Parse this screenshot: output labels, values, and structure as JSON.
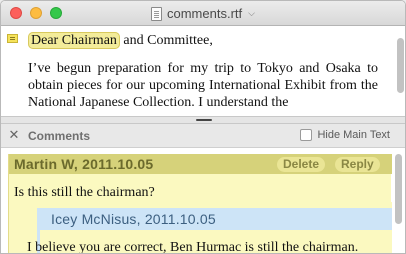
{
  "window": {
    "filename": "comments.rtf"
  },
  "document": {
    "paragraphs": [
      {
        "highlight": "Dear Chairman",
        "rest": " and Committee,"
      },
      {
        "text": "I’ve begun preparation for my trip to Tokyo and Osaka to obtain pieces for our upcoming International Exhibit from the National Japanese Collection. I understand the"
      }
    ]
  },
  "comments_panel": {
    "title": "Comments",
    "hide_main_text_label": "Hide Main Text",
    "hide_main_text_checked": false,
    "comment": {
      "author_date": "Martin W, 2011.10.05",
      "delete_label": "Delete",
      "reply_label": "Reply",
      "text": "Is this still the chairman?"
    },
    "reply": {
      "author_date": "Icey McNisus, 2011.10.05",
      "text": "I believe you are correct, Ben Hurmac is still the chairman."
    }
  },
  "colors": {
    "comment_header": "#d6d27a",
    "comment_background": "#fbf9c0",
    "reply_header": "#cde4f7",
    "highlight": "#f3ec9a"
  }
}
